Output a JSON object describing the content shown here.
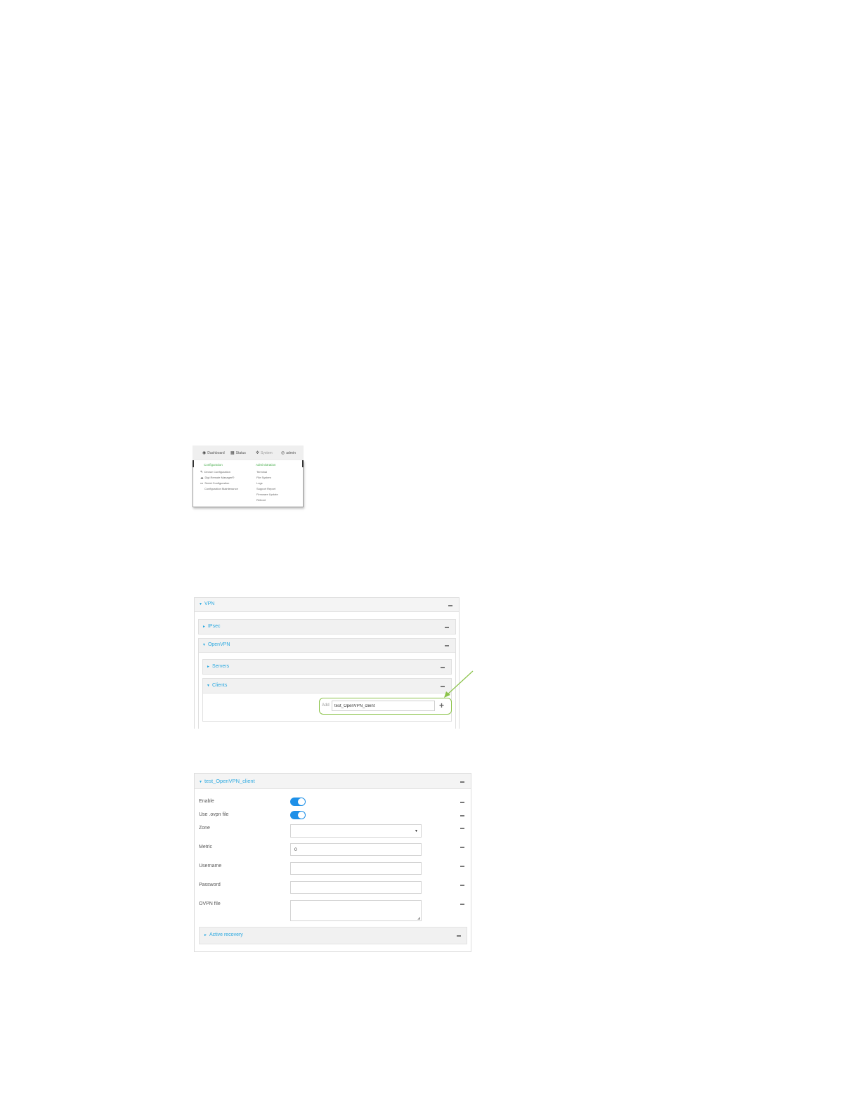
{
  "menu": {
    "nav": [
      {
        "icon": "dashboard-icon",
        "glyph": "◉",
        "label": "Dashboard"
      },
      {
        "icon": "status-icon",
        "glyph": "▦",
        "label": "Status"
      },
      {
        "icon": "gear-icon",
        "glyph": "✲",
        "label": "System"
      },
      {
        "icon": "user-icon",
        "glyph": "◎",
        "label": "admin"
      }
    ],
    "configuration_heading": "Configuration",
    "administration_heading": "Administration",
    "configuration_items": [
      {
        "icon": "wrench-icon",
        "glyph": "✎",
        "label": "Device Configuration"
      },
      {
        "icon": "cloud-icon",
        "glyph": "☁",
        "label": "Digi Remote Manager®"
      },
      {
        "icon": "terminal-icon",
        "glyph": "▭",
        "label": "Serial Configuration"
      },
      {
        "icon": "",
        "glyph": "",
        "label": "Configuration Maintenance"
      }
    ],
    "administration_items": [
      "Terminal",
      "File System",
      "Logs",
      "Support Report",
      "Firmware Update",
      "Reboot"
    ]
  },
  "vpn": {
    "title": "VPN",
    "ipsec": "IPsec",
    "openvpn": "OpenVPN",
    "servers": "Servers",
    "clients": "Clients",
    "add_label": "Add",
    "add_value": "test_OpenVPN_client"
  },
  "client": {
    "title": "test_OpenVPN_client",
    "fields": {
      "enable": "Enable",
      "use_ovpn": "Use .ovpn file",
      "zone": "Zone",
      "metric": "Metric",
      "metric_value": "0",
      "username": "Username",
      "password": "Password",
      "ovpn_file": "OVPN file"
    },
    "enable_on": true,
    "use_ovpn_on": true,
    "active_recovery": "Active recovery"
  },
  "colors": {
    "accent": "#29a8e0",
    "toggle": "#1e90e8",
    "highlight": "#8bc34a",
    "menu_heading": "#4caf50"
  }
}
